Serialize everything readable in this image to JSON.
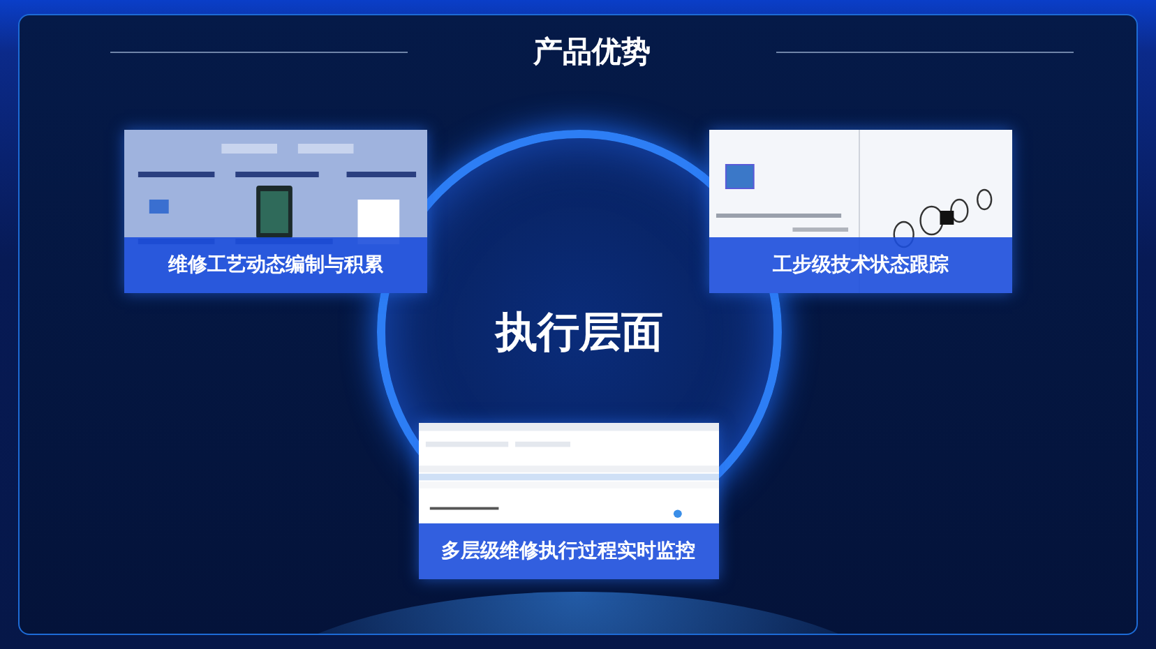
{
  "title": "产品优势",
  "center_label": "执行层面",
  "cards": [
    {
      "kind": "diagram",
      "caption": "维修工艺动态编制与积累"
    },
    {
      "kind": "parts",
      "caption": "工步级技术状态跟踪"
    },
    {
      "kind": "table",
      "caption": "多层级维修执行过程实时监控"
    }
  ]
}
